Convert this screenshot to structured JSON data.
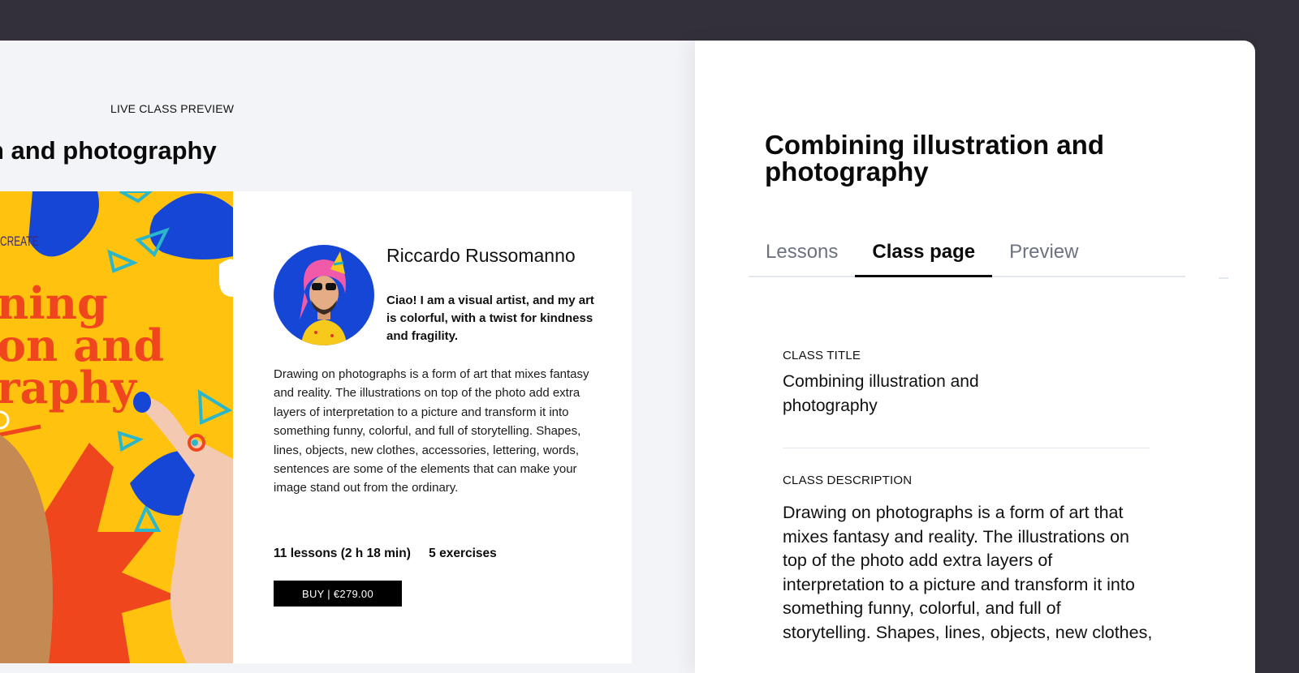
{
  "preview": {
    "label": "LIVE CLASS PREVIEW",
    "title": "n and photography",
    "hero_brand": "CREATE",
    "hero_poster_text": "ning\non and\nraphy"
  },
  "instructor": {
    "name": "Riccardo Russomanno",
    "bio": "Ciao! I am a visual artist, and my art is colorful, with a twist for kindness and fragility."
  },
  "class": {
    "description": "Drawing on photographs is a form of art that mixes fantasy and reality. The illustrations on top of the photo add extra layers of interpretation to a picture and transform it into something funny, colorful, and full of storytelling. Shapes, lines, objects, new clothes, accessories, lettering, words, sentences are some of the elements that can make your image stand out from the ordinary.",
    "lessons": "11 lessons (2 h 18 min)",
    "exercises": "5 exercises",
    "buy_label": "BUY | €279.00"
  },
  "editor": {
    "title": "Combining illustration and photography",
    "tabs": [
      {
        "label": "Lessons",
        "active": false
      },
      {
        "label": "Class page",
        "active": true
      },
      {
        "label": "Preview",
        "active": false
      }
    ],
    "class_title_label": "CLASS TITLE",
    "class_title_value": "Combining illustration and photography",
    "class_description_label": "CLASS DESCRIPTION",
    "class_description_value": "Drawing on photographs is a form of art that mixes fantasy and reality. The illustrations on top of the photo add extra layers of interpretation to a picture and transform it into something funny, colorful, and full of storytelling. Shapes, lines, objects, new clothes,"
  },
  "colors": {
    "background": "#33303a",
    "hero_yellow": "#ffc20e",
    "hero_blue": "#1546d6",
    "hero_orange": "#f0461e",
    "button": "#000000"
  }
}
